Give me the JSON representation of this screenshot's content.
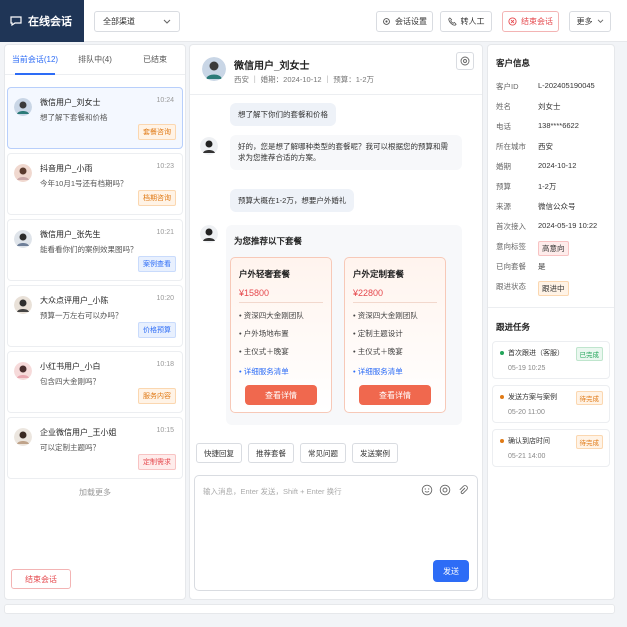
{
  "app": {
    "title": "在线会话"
  },
  "header": {
    "channel": "全部渠道",
    "settings_label": "会话设置",
    "transfer_label": "转人工",
    "end_label": "结束会话",
    "more_label": "更多"
  },
  "left": {
    "tabs": [
      "当前会话(12)",
      "排队中(4)",
      "已结束"
    ],
    "sessions": [
      {
        "name": "微信用户_刘女士",
        "time": "10:24",
        "msg": "想了解下套餐和价格",
        "badge": "套餐咨询"
      },
      {
        "name": "抖音用户_小雨",
        "time": "10:23",
        "msg": "今年10月1号还有档期吗？",
        "badge": "档期咨询"
      },
      {
        "name": "微信用户_张先生",
        "time": "10:21",
        "msg": "能看看你们的案例效果图吗？",
        "badge": "案例查看"
      },
      {
        "name": "大众点评用户_小陈",
        "time": "10:20",
        "msg": "预算一万左右可以办吗？",
        "badge": "价格预算"
      },
      {
        "name": "小红书用户_小白",
        "time": "10:18",
        "msg": "包含四大金刚吗？",
        "badge": "服务内容"
      },
      {
        "name": "企业微信用户_王小姐",
        "time": "10:15",
        "msg": "可以定制主题吗？",
        "badge": "定制需求"
      }
    ],
    "load_more": "加载更多",
    "end_button": "结束会话"
  },
  "chat": {
    "name": "微信用户_刘女士",
    "meta": "西安  ｜  婚期：2024-10-12  ｜  预算：1-2万",
    "messages": [
      "想了解下你们的套餐和价格",
      "好的，您是想了解哪种类型的套餐呢？我可以根据您的预算和需求为您推荐合适的方案。",
      "预算大概在1-2万，想要户外婚礼"
    ],
    "rec_title": "为您推荐以下套餐",
    "cards": [
      {
        "title": "户外轻奢套餐",
        "price": "¥15800",
        "features": [
          "资深四大金刚团队",
          "户外场地布置",
          "主仪式＋晚宴"
        ],
        "link": "详细服务清单",
        "button": "查看详情"
      },
      {
        "title": "户外定制套餐",
        "price": "¥22800",
        "features": [
          "资深四大金刚团队",
          "定制主题设计",
          "主仪式＋晚宴"
        ],
        "link": "详细服务清单",
        "button": "查看详情"
      }
    ],
    "quick_replies": [
      "快捷回复",
      "推荐套餐",
      "常见问题",
      "发送案例"
    ],
    "input_placeholder": "输入消息，Enter 发送，Shift + Enter 换行",
    "send_label": "发送"
  },
  "customer": {
    "title": "客户信息",
    "fields": [
      {
        "k": "客户ID",
        "v": "L-202405190045"
      },
      {
        "k": "姓名",
        "v": "刘女士"
      },
      {
        "k": "电话",
        "v": "138****6622"
      },
      {
        "k": "所在城市",
        "v": "西安"
      },
      {
        "k": "婚期",
        "v": "2024-10-12"
      },
      {
        "k": "预算",
        "v": "1-2万"
      },
      {
        "k": "来源",
        "v": "微信公众号"
      },
      {
        "k": "首次接入",
        "v": "2024-05-19 10:22"
      },
      {
        "k": "意向标签",
        "v": "高意向"
      },
      {
        "k": "已向套餐",
        "v": "是"
      },
      {
        "k": "跟进状态",
        "v": "跟进中"
      }
    ],
    "tasks_title": "跟进任务",
    "tasks": [
      {
        "name": "首次跟进（客服）",
        "time": "05-19 10:25",
        "status": "已完成"
      },
      {
        "name": "发送方案与案例",
        "time": "05-20 11:00",
        "status": "待完成"
      },
      {
        "name": "确认到店时间",
        "time": "05-21 14:00",
        "status": "待完成"
      }
    ]
  },
  "colors": {
    "accent": "#2d6cf6",
    "danger": "#e5484d",
    "warning": "#e07a16",
    "success": "#23a55a",
    "nav": "#1f3556"
  }
}
